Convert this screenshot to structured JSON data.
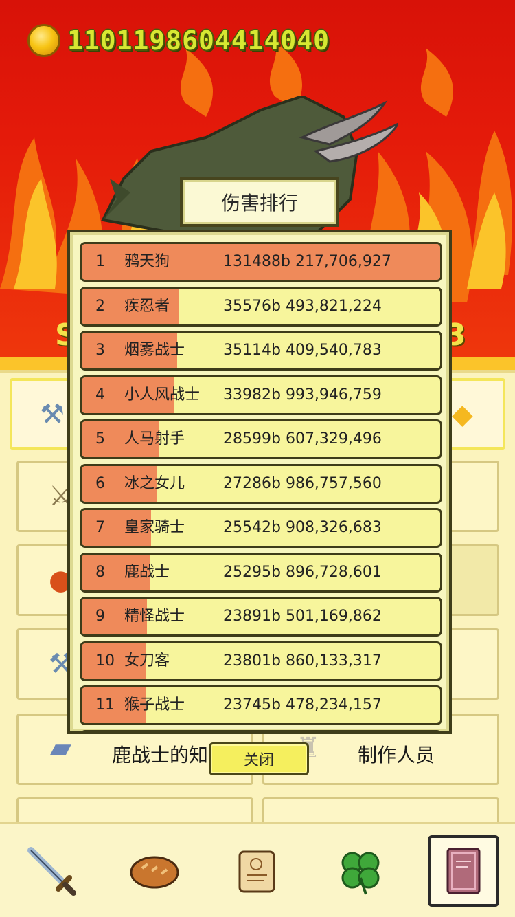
{
  "header": {
    "coin_icon": "gold-coin-icon",
    "coin_amount": "1101198604414040"
  },
  "background": {
    "stat_left": "S",
    "stat_right": "3"
  },
  "menu": {
    "items": [
      {
        "label": "鹿战士的知识",
        "icon": "book-icon"
      },
      {
        "label": "制作人员",
        "icon": "trophy-cup-icon"
      }
    ]
  },
  "modal": {
    "title": "伤害排行",
    "close_label": "关闭",
    "rows": [
      {
        "rank": "1",
        "name": "鸦天狗",
        "damage": "131488b 217,706,927",
        "fill": 1.0
      },
      {
        "rank": "2",
        "name": "疾忍者",
        "damage": "35576b 493,821,224",
        "fill": 0.271
      },
      {
        "rank": "3",
        "name": "烟雾战士",
        "damage": "35114b 409,540,783",
        "fill": 0.267
      },
      {
        "rank": "4",
        "name": "小人风战士",
        "damage": "33982b 993,946,759",
        "fill": 0.258
      },
      {
        "rank": "5",
        "name": "人马射手",
        "damage": "28599b 607,329,496",
        "fill": 0.217
      },
      {
        "rank": "6",
        "name": "冰之女儿",
        "damage": "27286b 986,757,560",
        "fill": 0.208
      },
      {
        "rank": "7",
        "name": "皇家骑士",
        "damage": "25542b 908,326,683",
        "fill": 0.194
      },
      {
        "rank": "8",
        "name": "鹿战士",
        "damage": "25295b 896,728,601",
        "fill": 0.192
      },
      {
        "rank": "9",
        "name": "精怪战士",
        "damage": "23891b 501,169,862",
        "fill": 0.182
      },
      {
        "rank": "10",
        "name": "女刀客",
        "damage": "23801b 860,133,317",
        "fill": 0.181
      },
      {
        "rank": "11",
        "name": "猴子战士",
        "damage": "23745b 478,234,157",
        "fill": 0.181
      }
    ]
  },
  "bottom_nav": {
    "items": [
      {
        "icon": "sword-icon"
      },
      {
        "icon": "bread-icon"
      },
      {
        "icon": "scroll-icon"
      },
      {
        "icon": "clover-icon"
      },
      {
        "icon": "spellbook-icon",
        "active": true
      }
    ]
  },
  "colors": {
    "fire_red": "#d81208",
    "panel_cream": "#fbf3bd",
    "rank_fill": "#ef8a5a",
    "row_yellow": "#f7f59c"
  }
}
